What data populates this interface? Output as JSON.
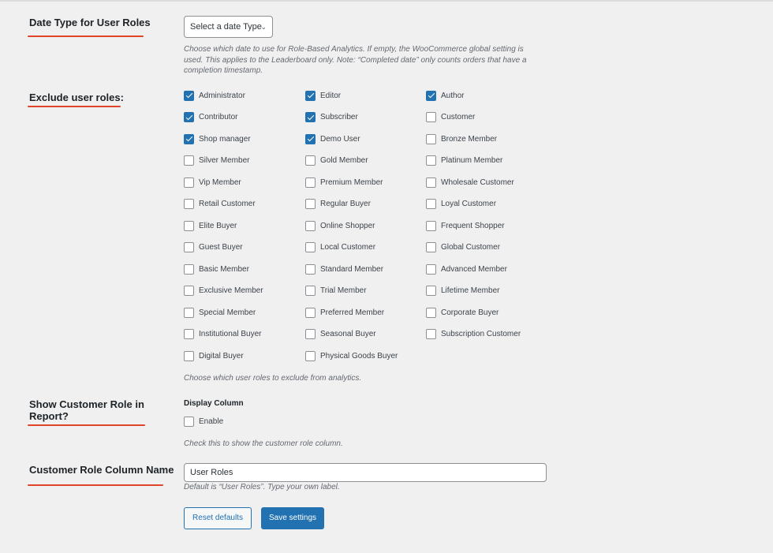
{
  "date_type": {
    "label": "Date Type for User Roles",
    "select_value": "Select a date Type",
    "description_lines": [
      "Choose which date to use for Role-Based Analytics. If empty, the WooCommerce global setting is",
      "used. This applies to the Leaderboard only. Note: “Completed date” only counts orders that have a",
      "completion timestamp."
    ]
  },
  "exclude_roles": {
    "label": "Exclude user roles:",
    "description": "Choose which user roles to exclude from analytics.",
    "columns": [
      [
        {
          "label": "Administrator",
          "checked": true
        },
        {
          "label": "Contributor",
          "checked": true
        },
        {
          "label": "Shop manager",
          "checked": true
        },
        {
          "label": "Silver Member",
          "checked": false
        },
        {
          "label": "Vip Member",
          "checked": false
        },
        {
          "label": "Retail Customer",
          "checked": false
        },
        {
          "label": "Elite Buyer",
          "checked": false
        },
        {
          "label": "Guest Buyer",
          "checked": false
        },
        {
          "label": "Basic Member",
          "checked": false
        },
        {
          "label": "Exclusive Member",
          "checked": false
        },
        {
          "label": "Special Member",
          "checked": false
        },
        {
          "label": "Institutional Buyer",
          "checked": false
        },
        {
          "label": "Digital Buyer",
          "checked": false
        }
      ],
      [
        {
          "label": "Editor",
          "checked": true
        },
        {
          "label": "Subscriber",
          "checked": true
        },
        {
          "label": "Demo User",
          "checked": true
        },
        {
          "label": "Gold Member",
          "checked": false
        },
        {
          "label": "Premium Member",
          "checked": false
        },
        {
          "label": "Regular Buyer",
          "checked": false
        },
        {
          "label": "Online Shopper",
          "checked": false
        },
        {
          "label": "Local Customer",
          "checked": false
        },
        {
          "label": "Standard Member",
          "checked": false
        },
        {
          "label": "Trial Member",
          "checked": false
        },
        {
          "label": "Preferred Member",
          "checked": false
        },
        {
          "label": "Seasonal Buyer",
          "checked": false
        },
        {
          "label": "Physical Goods Buyer",
          "checked": false
        }
      ],
      [
        {
          "label": "Author",
          "checked": true
        },
        {
          "label": "Customer",
          "checked": false
        },
        {
          "label": "Bronze Member",
          "checked": false
        },
        {
          "label": "Platinum Member",
          "checked": false
        },
        {
          "label": "Wholesale Customer",
          "checked": false
        },
        {
          "label": "Loyal Customer",
          "checked": false
        },
        {
          "label": "Frequent Shopper",
          "checked": false
        },
        {
          "label": "Global Customer",
          "checked": false
        },
        {
          "label": "Advanced Member",
          "checked": false
        },
        {
          "label": "Lifetime Member",
          "checked": false
        },
        {
          "label": "Corporate Buyer",
          "checked": false
        },
        {
          "label": "Subscription Customer",
          "checked": false
        }
      ]
    ]
  },
  "show_role": {
    "label_line1": "Show Customer Role in",
    "label_line2": "Report?",
    "sub_heading": "Display Column",
    "checkbox_label": "Enable",
    "checked": false,
    "description": "Check this to show the customer role column."
  },
  "column_name": {
    "label": "Customer Role Column Name",
    "value": "User Roles",
    "description": "Default is “User Roles”. Type your own label."
  },
  "buttons": {
    "reset_label": "Reset defaults",
    "save_label": "Save settings"
  },
  "colors": {
    "accent": "#2271b1",
    "underline": "#e0442b",
    "background": "#f0f0f1"
  }
}
